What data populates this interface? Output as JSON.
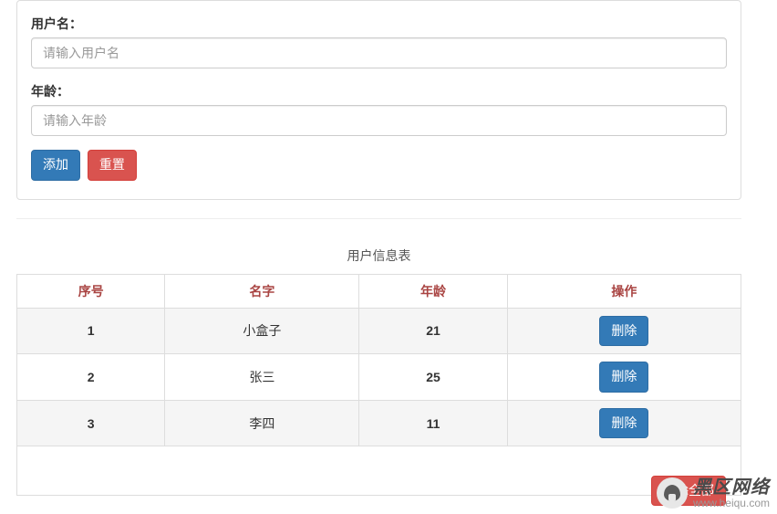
{
  "form": {
    "username_label": "用户名：",
    "username_placeholder": "请输入用户名",
    "username_value": "",
    "age_label": "年龄：",
    "age_placeholder": "请输入年龄",
    "age_value": "",
    "add_label": "添加",
    "reset_label": "重置"
  },
  "table": {
    "caption": "用户信息表",
    "headers": {
      "index": "序号",
      "name": "名字",
      "age": "年龄",
      "action": "操作"
    },
    "delete_label": "删除",
    "delete_all_label": "删除全部",
    "rows": [
      {
        "index": "1",
        "name": "小盒子",
        "age": "21"
      },
      {
        "index": "2",
        "name": "张三",
        "age": "25"
      },
      {
        "index": "3",
        "name": "李四",
        "age": "11"
      }
    ]
  },
  "watermark": {
    "title": "黑区网络",
    "url": "www.heiqu.com"
  }
}
